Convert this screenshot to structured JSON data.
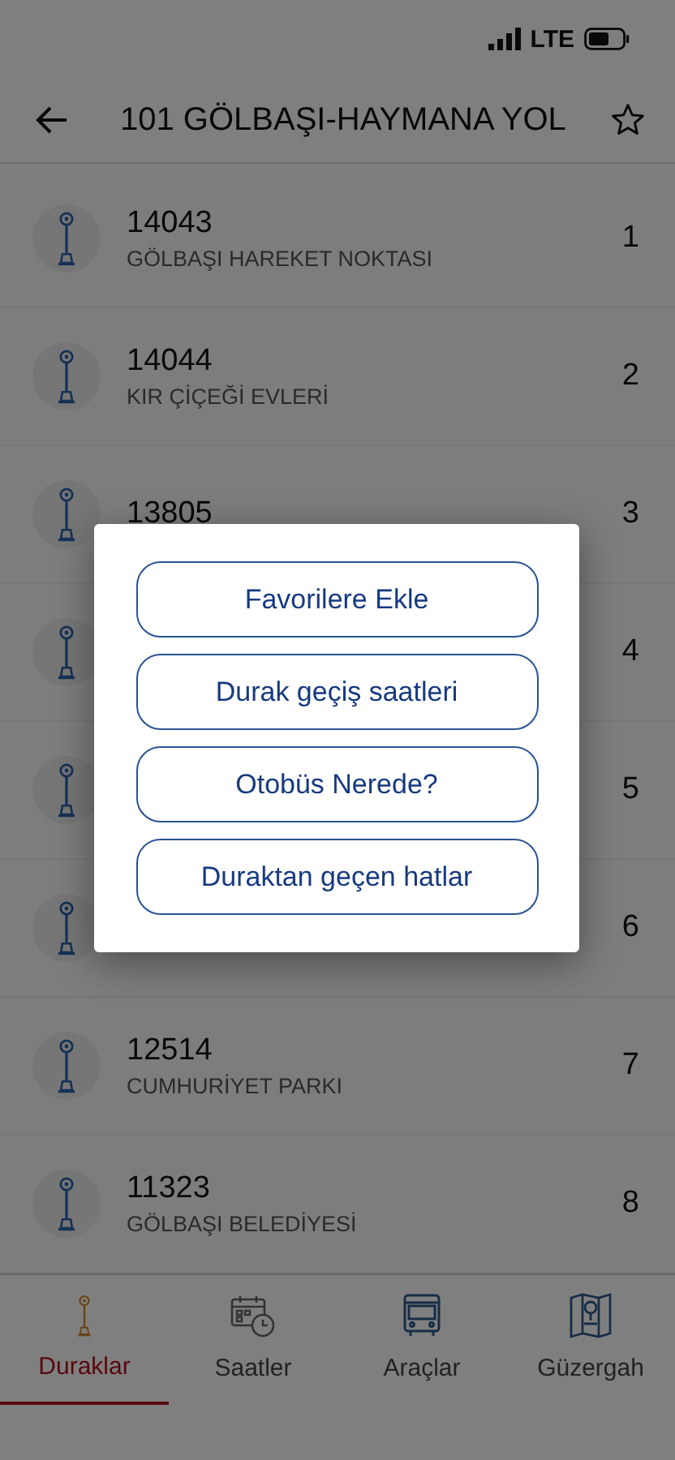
{
  "status_bar": {
    "network": "LTE"
  },
  "header": {
    "title": "101 GÖLBAŞI-HAYMANA YOL",
    "favorite": false
  },
  "stops": [
    {
      "code": "14043",
      "name": "GÖLBAŞI HAREKET NOKTASI",
      "order": "1"
    },
    {
      "code": "14044",
      "name": "KIR ÇİÇEĞİ EVLERİ",
      "order": "2"
    },
    {
      "code": "13805",
      "order": "3"
    },
    {
      "order": "4"
    },
    {
      "order": "5"
    },
    {
      "order": "6"
    },
    {
      "code": "12514",
      "name": "CUMHURİYET PARKI",
      "order": "7"
    },
    {
      "code": "11323",
      "name": "GÖLBAŞI BELEDİYESİ",
      "order": "8"
    }
  ],
  "dialog": {
    "buttons": [
      "Favorilere Ekle",
      "Durak geçiş saatleri",
      "Otobüs Nerede?",
      "Duraktan geçen hatlar"
    ]
  },
  "tabs": [
    {
      "label": "Duraklar",
      "kind": "stops",
      "selected": true
    },
    {
      "label": "Saatler",
      "kind": "schedule",
      "selected": false
    },
    {
      "label": "Araçlar",
      "kind": "vehicles",
      "selected": false
    },
    {
      "label": "Güzergah",
      "kind": "route",
      "selected": false
    }
  ]
}
